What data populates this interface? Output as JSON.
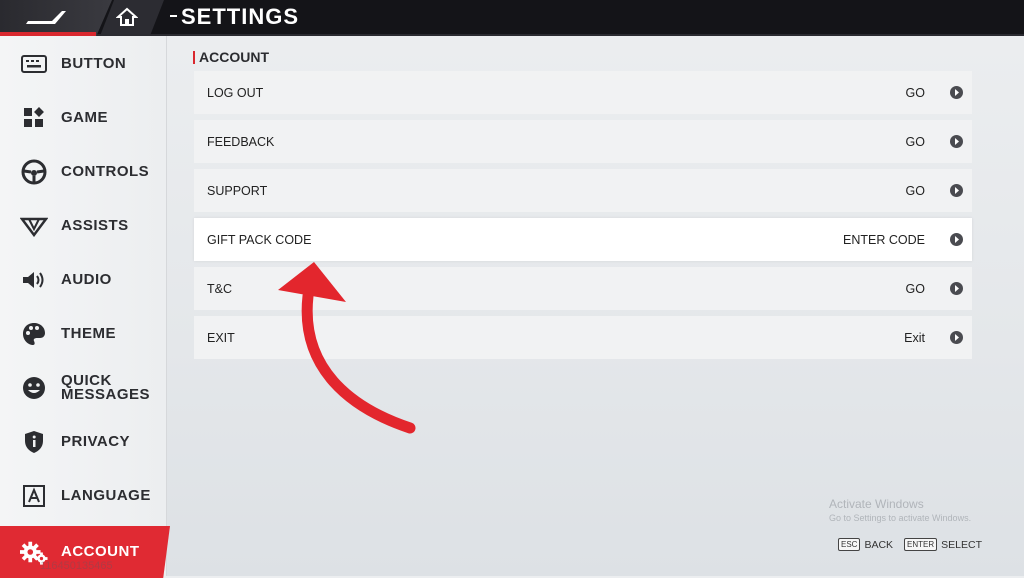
{
  "header": {
    "title": "SETTINGS"
  },
  "sidebar": {
    "items": [
      {
        "label": "BUTTON",
        "icon": "keyboard-icon"
      },
      {
        "label": "GAME",
        "icon": "game-grid-icon"
      },
      {
        "label": "CONTROLS",
        "icon": "steering-wheel-icon"
      },
      {
        "label": "ASSISTS",
        "icon": "assists-icon"
      },
      {
        "label": "AUDIO",
        "icon": "speaker-icon"
      },
      {
        "label": "THEME",
        "icon": "palette-icon"
      },
      {
        "label": "QUICK",
        "label2": "MESSAGES",
        "icon": "smiley-icon"
      },
      {
        "label": "PRIVACY",
        "icon": "shield-icon"
      },
      {
        "label": "LANGUAGE",
        "icon": "language-icon"
      },
      {
        "label": "ACCOUNT",
        "icon": "gears-icon",
        "active": true
      }
    ],
    "user_id": "116450135465"
  },
  "main": {
    "section_title": "ACCOUNT",
    "rows": [
      {
        "label": "LOG OUT",
        "action": "GO"
      },
      {
        "label": "FEEDBACK",
        "action": "GO"
      },
      {
        "label": "SUPPORT",
        "action": "GO"
      },
      {
        "label": "GIFT PACK CODE",
        "action": "ENTER CODE",
        "selected": true
      },
      {
        "label": "T&C",
        "action": "GO"
      },
      {
        "label": "EXIT",
        "action": "Exit"
      }
    ]
  },
  "watermark": {
    "line1": "Activate Windows",
    "line2": "Go to Settings to activate Windows."
  },
  "hints": [
    {
      "key": "ESC",
      "label": "BACK"
    },
    {
      "key": "ENTER",
      "label": "SELECT"
    }
  ],
  "colors": {
    "accent": "#e02a33",
    "topbar": "#141418",
    "row": "#f1f2f3",
    "row_selected": "#ffffff"
  }
}
